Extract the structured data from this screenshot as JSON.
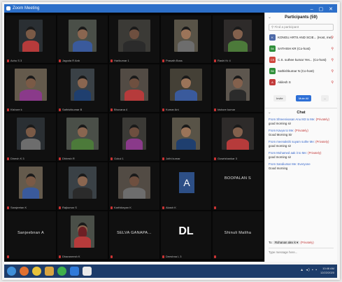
{
  "window": {
    "title": "Zoom Meeting",
    "controls": "– ▢ ✕"
  },
  "tiles": [
    {
      "name": "Achu S 3"
    },
    {
      "name": "Jagoda R Anb"
    },
    {
      "name": "Harikumar 1"
    },
    {
      "name": "Prasath Boss"
    },
    {
      "name": "Rashi Kr 4"
    },
    {
      "name": "Kishore k"
    },
    {
      "name": "Sathishkumar B"
    },
    {
      "name": "Bhuvana 4"
    },
    {
      "name": "Kumar Ani"
    },
    {
      "name": "kishore kumar"
    },
    {
      "name": "Dinesh K 3"
    },
    {
      "name": "Dhiresh R"
    },
    {
      "name": "Gokul 1"
    },
    {
      "name": "Jothi kumar"
    },
    {
      "name": "Gowrishankar 3"
    },
    {
      "name": "Sarajeetan K"
    },
    {
      "name": "Rajkumar S"
    },
    {
      "name": "Karthikeyan K"
    },
    {
      "name": "Akash K",
      "initials": "A"
    },
    {
      "name": "",
      "big_name": "BOOPALAN S"
    },
    {
      "name": "",
      "big_name": "Sanjeebnan A"
    },
    {
      "name": "Dharaneesh K"
    },
    {
      "name": "",
      "big_name": "SELVA GANAPA..."
    },
    {
      "name": "Deeshna L 3",
      "initials": "DL"
    },
    {
      "name": "",
      "big_name": "Shinuli Maliha"
    }
  ],
  "participants": {
    "title": "Participants (59)",
    "search_placeholder": "Find a participant",
    "list": [
      {
        "initials": "K",
        "name": "KONGU ARTS AND SCIE... (Host, me)",
        "color": "#4e6aa8"
      },
      {
        "initials": "SK",
        "name": "SATHISH KR (Co-host)",
        "color": "#2f8f3a"
      },
      {
        "initials": "CS",
        "name": "C.S. suthee kumar Yes... (Co-host)",
        "color": "#d0473d"
      },
      {
        "initials": "SK",
        "name": "Sathishkumar N (Co-host)",
        "color": "#2f8f3a"
      },
      {
        "initials": "A",
        "name": "Akilesh S",
        "color": "#c23b3b"
      }
    ],
    "buttons": {
      "invite": "Invite",
      "mute_all": "Mute All",
      "more": "..."
    }
  },
  "chat": {
    "title": "Chat",
    "messages": [
      {
        "from": "From Shreenivasan Anu M3 to Me:",
        "flag": "(Privately)",
        "text": "good morning sir"
      },
      {
        "from": "From Kavya to Me:",
        "flag": "(Privately)",
        "text": "Good Morning Sir"
      },
      {
        "from": "From meenakshi suyam suthe Me:",
        "flag": "(Privately)",
        "text": "good morning sir"
      },
      {
        "from": "From Mohamed aak it to Me:",
        "flag": "(Privately)",
        "text": "good morning sir"
      },
      {
        "from": "From Sandiumar Me: Everyone",
        "flag": "",
        "text": "Good morning"
      }
    ],
    "to_label": "To:",
    "to_value": "Rohanan alex k ▾",
    "to_flag": "(Privately)",
    "input_placeholder": "Type message here..."
  },
  "taskbar": {
    "tray": "▲ ◂) ▪ ▪",
    "time": "10:46 AM",
    "date": "12/22/2020"
  }
}
